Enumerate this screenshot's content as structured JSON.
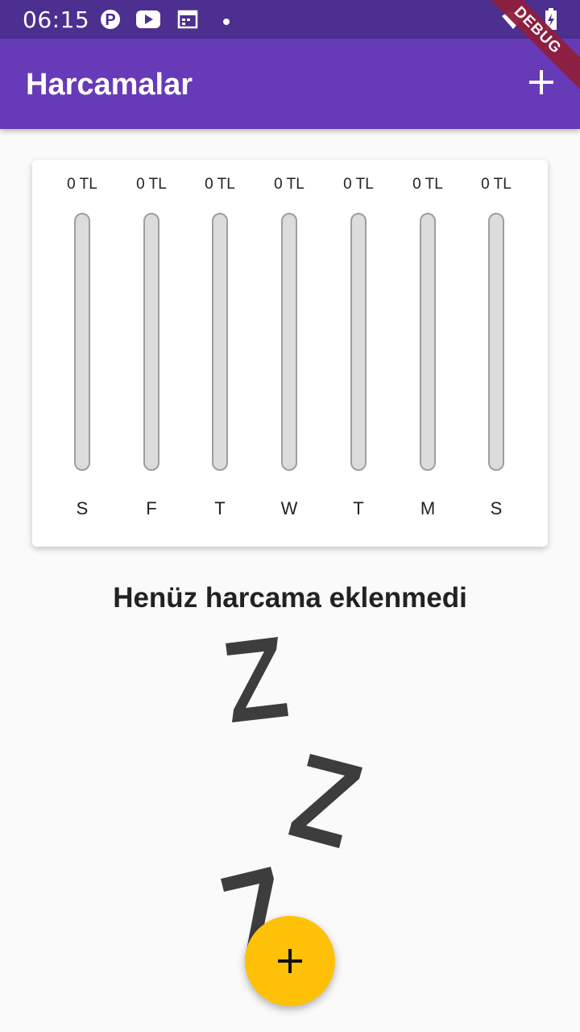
{
  "status_bar": {
    "time": "06:15",
    "icons": [
      "parking-app-icon",
      "youtube-icon",
      "calendar-icon",
      "dot-icon",
      "wifi-icon",
      "battery-charging-icon"
    ]
  },
  "debug_banner": "DEBUG",
  "app_bar": {
    "title": "Harcamalar",
    "action_icon": "add-icon"
  },
  "chart": {
    "bars": [
      {
        "day": "S",
        "amount": "0 TL",
        "fill": 0
      },
      {
        "day": "F",
        "amount": "0 TL",
        "fill": 0
      },
      {
        "day": "T",
        "amount": "0 TL",
        "fill": 0
      },
      {
        "day": "W",
        "amount": "0 TL",
        "fill": 0
      },
      {
        "day": "T",
        "amount": "0 TL",
        "fill": 0
      },
      {
        "day": "M",
        "amount": "0 TL",
        "fill": 0
      },
      {
        "day": "S",
        "amount": "0 TL",
        "fill": 0
      }
    ]
  },
  "empty_state": {
    "message": "Henüz harcama eklenmedi",
    "image": "sleeping-zzz-illustration"
  },
  "fab": {
    "icon": "add-icon",
    "color": "#ffc107"
  },
  "colors": {
    "primary": "#673ab7",
    "status_bar": "#4c2f8e",
    "accent": "#ffc107"
  }
}
